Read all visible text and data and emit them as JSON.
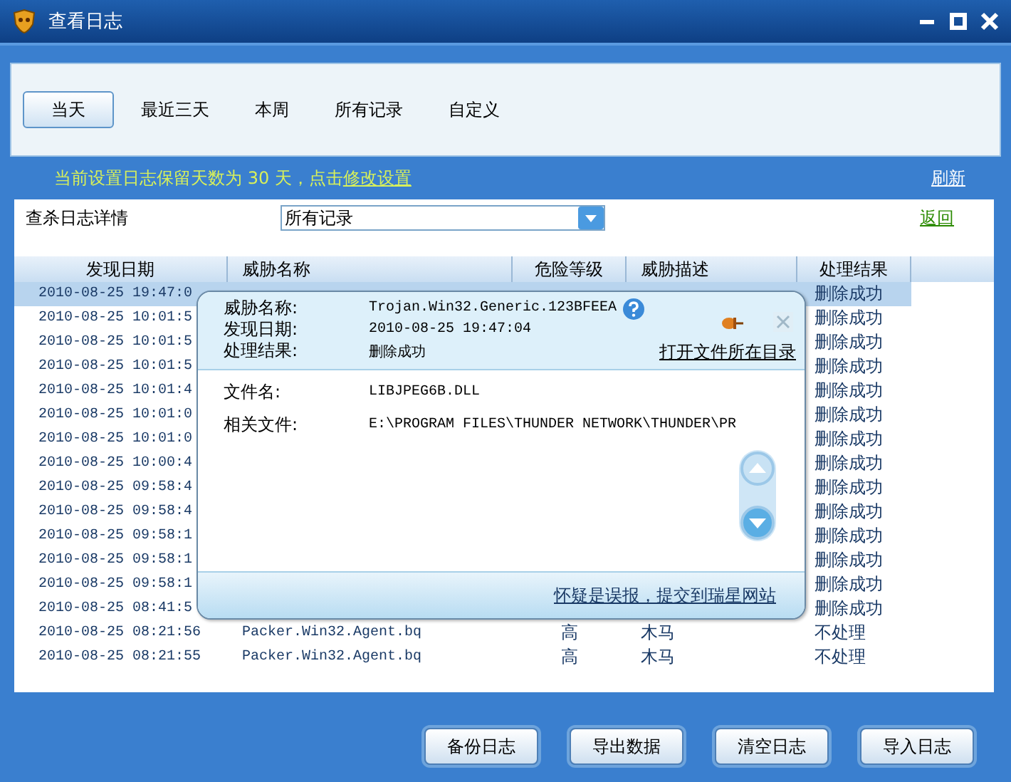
{
  "window": {
    "title": "查看日志"
  },
  "tabs": [
    {
      "label": "当天",
      "selected": true
    },
    {
      "label": "最近三天",
      "selected": false
    },
    {
      "label": "本周",
      "selected": false
    },
    {
      "label": "所有记录",
      "selected": false
    },
    {
      "label": "自定义",
      "selected": false
    }
  ],
  "retention_notice": {
    "text": "当前设置日志保留天数为 30 天，点击",
    "link": "修改设置"
  },
  "refresh_link": "刷新",
  "filter": {
    "label": "查杀日志详情",
    "value": "所有记录"
  },
  "back_link": "返回",
  "table": {
    "columns": [
      "发现日期",
      "威胁名称",
      "危险等级",
      "威胁描述",
      "处理结果"
    ],
    "rows": [
      {
        "date": "2010-08-25 19:47:0",
        "result": "删除成功",
        "selected": true
      },
      {
        "date": "2010-08-25 10:01:5",
        "result": "删除成功",
        "selected": false
      },
      {
        "date": "2010-08-25 10:01:5",
        "result": "删除成功",
        "selected": false
      },
      {
        "date": "2010-08-25 10:01:5",
        "result": "删除成功",
        "selected": false
      },
      {
        "date": "2010-08-25 10:01:4",
        "result": "删除成功",
        "selected": false
      },
      {
        "date": "2010-08-25 10:01:0",
        "result": "删除成功",
        "selected": false
      },
      {
        "date": "2010-08-25 10:01:0",
        "result": "删除成功",
        "selected": false
      },
      {
        "date": "2010-08-25 10:00:4",
        "result": "删除成功",
        "selected": false
      },
      {
        "date": "2010-08-25 09:58:4",
        "result": "删除成功",
        "selected": false
      },
      {
        "date": "2010-08-25 09:58:4",
        "result": "删除成功",
        "selected": false
      },
      {
        "date": "2010-08-25 09:58:1",
        "result": "删除成功",
        "selected": false
      },
      {
        "date": "2010-08-25 09:58:1",
        "result": "删除成功",
        "selected": false
      },
      {
        "date": "2010-08-25 09:58:1",
        "result": "删除成功",
        "selected": false
      },
      {
        "date": "2010-08-25 08:41:5",
        "result": "删除成功",
        "selected": false
      },
      {
        "date": "2010-08-25 08:21:56",
        "name": "Packer.Win32.Agent.bq",
        "level": "高",
        "description": "木马",
        "result": "不处理",
        "selected": false
      },
      {
        "date": "2010-08-25 08:21:55",
        "name": "Packer.Win32.Agent.bq",
        "level": "高",
        "description": "木马",
        "result": "不处理",
        "selected": false
      }
    ]
  },
  "detail_popup": {
    "header_fields": [
      {
        "label": "威胁名称:",
        "value": "Trojan.Win32.Generic.123BFEEA"
      },
      {
        "label": "发现日期:",
        "value": "2010-08-25 19:47:04"
      },
      {
        "label": "处理结果:",
        "value": "删除成功"
      }
    ],
    "open_folder_link": "打开文件所在目录",
    "body_fields": [
      {
        "label": "文件名:",
        "value": "LIBJPEG6B.DLL"
      },
      {
        "label": "相关文件:",
        "value": "E:\\PROGRAM FILES\\THUNDER NETWORK\\THUNDER\\PR"
      }
    ],
    "report_link": "怀疑是误报，提交到瑞星网站"
  },
  "buttons": [
    "备份日志",
    "导出数据",
    "清空日志",
    "导入日志"
  ]
}
